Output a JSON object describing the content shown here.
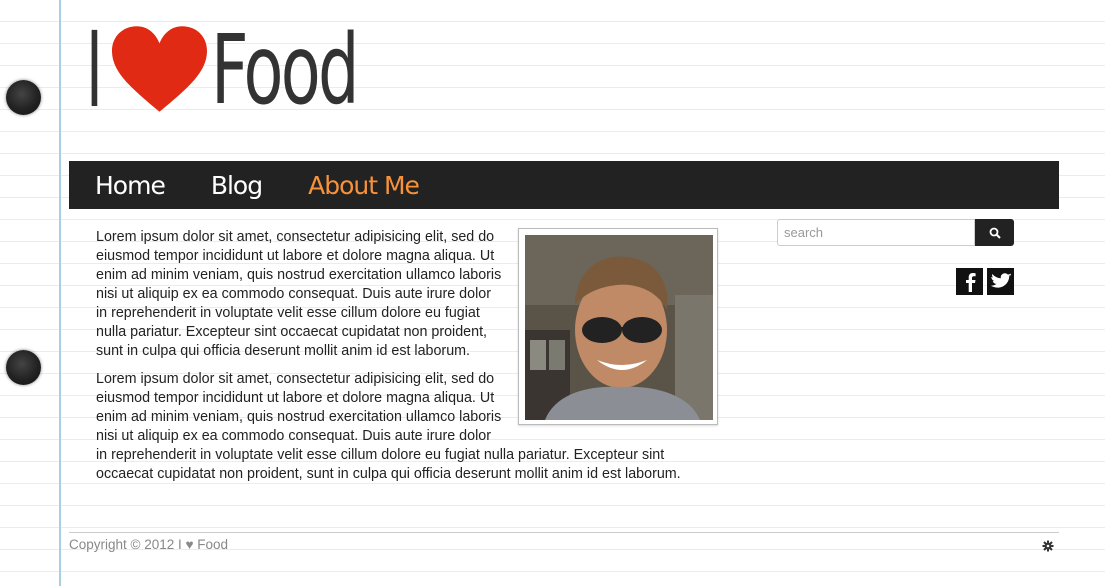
{
  "logo": {
    "text_before": "I",
    "heart_color": "#e02a14",
    "text_after": "Food"
  },
  "nav": {
    "items": [
      {
        "label": "Home"
      },
      {
        "label": "Blog"
      },
      {
        "label": "About Me"
      }
    ],
    "active_color": "#f8923a"
  },
  "content": {
    "paragraphs": [
      "Lorem ipsum dolor sit amet, consectetur adipisicing elit, sed do eiusmod tempor incididunt ut labore et dolore magna aliqua. Ut enim ad minim veniam, quis nostrud exercitation ullamco laboris nisi ut aliquip ex ea commodo consequat. Duis aute irure dolor in reprehenderit in voluptate velit esse cillum dolore eu fugiat nulla pariatur. Excepteur sint occaecat cupidatat non proident, sunt in culpa qui officia deserunt mollit anim id est laborum.",
      "Lorem ipsum dolor sit amet, consectetur adipisicing elit, sed do eiusmod tempor incididunt ut labore et dolore magna aliqua. Ut enim ad minim veniam, quis nostrud exercitation ullamco laboris nisi ut aliquip ex ea commodo consequat. Duis aute irure dolor in reprehenderit in voluptate velit esse cillum dolore eu fugiat nulla pariatur. Excepteur sint occaecat cupidatat non proident, sunt in culpa qui officia deserunt mollit anim id est laborum."
    ]
  },
  "sidebar": {
    "search": {
      "placeholder": "search",
      "button_icon": "search-icon"
    },
    "social": [
      {
        "icon": "facebook-icon"
      },
      {
        "icon": "twitter-icon"
      }
    ]
  },
  "footer": {
    "copyright": "Copyright © 2012 I ♥ Food",
    "icon": "gear-icon"
  }
}
